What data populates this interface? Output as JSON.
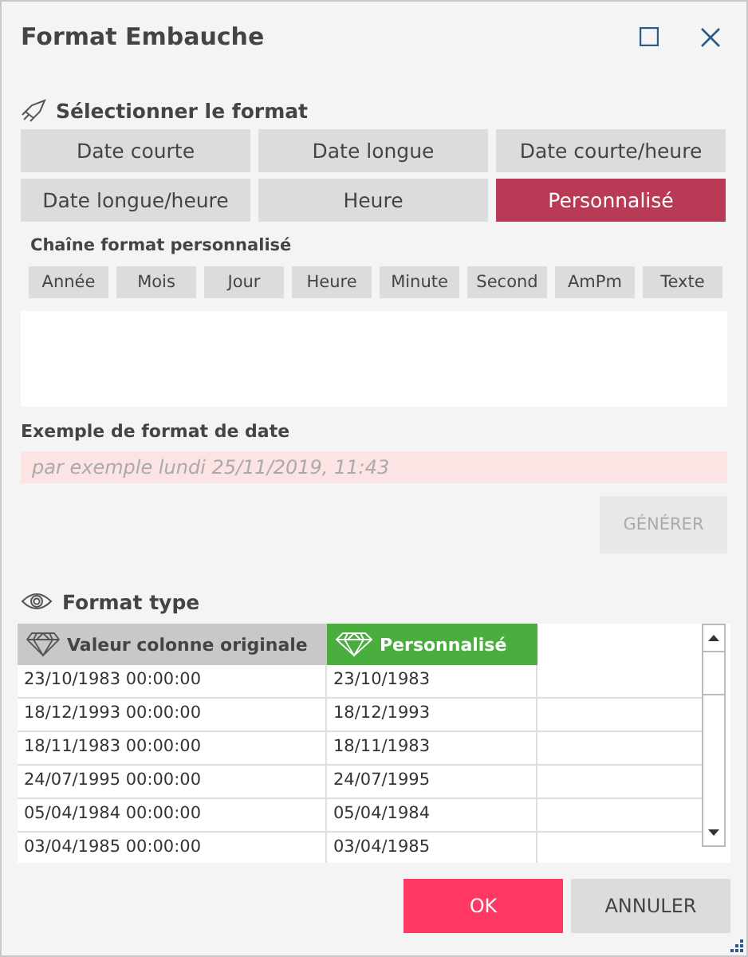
{
  "window": {
    "title": "Format Embauche"
  },
  "format_section": {
    "heading": "Sélectionner le format",
    "options": [
      {
        "label": "Date courte",
        "selected": false
      },
      {
        "label": "Date longue",
        "selected": false
      },
      {
        "label": "Date courte/heure",
        "selected": false
      },
      {
        "label": "Date longue/heure",
        "selected": false
      },
      {
        "label": "Heure",
        "selected": false
      },
      {
        "label": "Personnalisé",
        "selected": true
      }
    ]
  },
  "custom_format": {
    "label": "Chaîne format personnalisé",
    "tokens": [
      "Année",
      "Mois",
      "Jour",
      "Heure",
      "Minute",
      "Second",
      "AmPm",
      "Texte"
    ]
  },
  "example": {
    "label": "Exemple de format de date",
    "placeholder": "par exemple lundi 25/11/2019, 11:43"
  },
  "generate_button": {
    "label": "GÉNÉRER",
    "disabled": true
  },
  "preview": {
    "heading": "Format type",
    "columns": [
      "Valeur colonne originale",
      "Personnalisé"
    ],
    "rows": [
      [
        "23/10/1983 00:00:00",
        "23/10/1983"
      ],
      [
        "18/12/1993 00:00:00",
        "18/12/1993"
      ],
      [
        "18/11/1983 00:00:00",
        "18/11/1983"
      ],
      [
        "24/07/1995 00:00:00",
        "24/07/1995"
      ],
      [
        "05/04/1984 00:00:00",
        "05/04/1984"
      ],
      [
        "03/04/1985 00:00:00",
        "03/04/1985"
      ]
    ]
  },
  "buttons": [
    {
      "label": "OK",
      "kind": "primary"
    },
    {
      "label": "ANNULER",
      "kind": "secondary"
    }
  ]
}
